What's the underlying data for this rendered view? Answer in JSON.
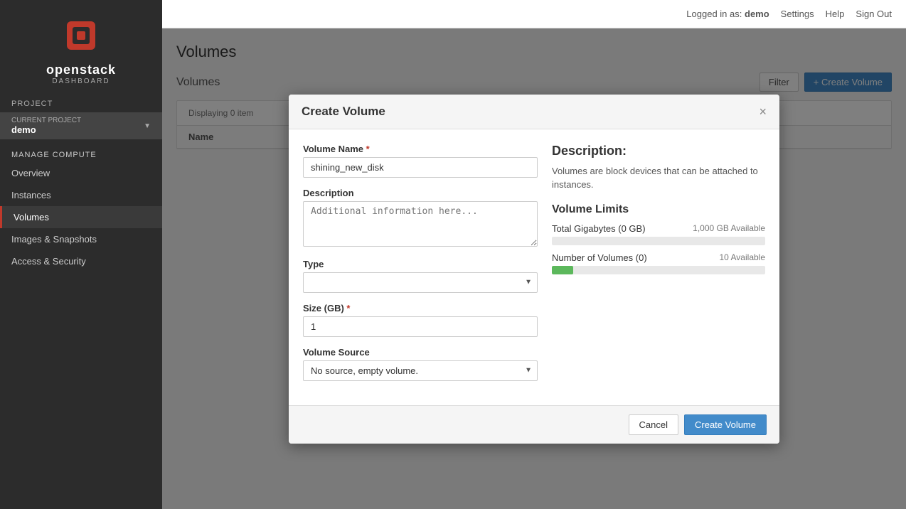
{
  "app": {
    "logo_alt": "OpenStack",
    "openstack_label": "openstack",
    "dashboard_label": "dashboard"
  },
  "topbar": {
    "logged_in_label": "Logged in as:",
    "username": "demo",
    "settings_label": "Settings",
    "help_label": "Help",
    "signout_label": "Sign Out"
  },
  "page": {
    "title": "Volumes",
    "subtitle": "Volumes",
    "filter_label": "Filter",
    "create_label": "+ Create Volume",
    "table_info": "Displaying 0 item"
  },
  "table": {
    "col_name": "Name"
  },
  "sidebar": {
    "project_label": "Project",
    "current_project_label": "CURRENT PROJECT",
    "current_project": "demo",
    "manage_compute_label": "Manage Compute",
    "items": [
      {
        "id": "overview",
        "label": "Overview",
        "active": false
      },
      {
        "id": "instances",
        "label": "Instances",
        "active": false
      },
      {
        "id": "volumes",
        "label": "Volumes",
        "active": true
      },
      {
        "id": "images-snapshots",
        "label": "Images & Snapshots",
        "active": false
      },
      {
        "id": "access-security",
        "label": "Access & Security",
        "active": false
      }
    ]
  },
  "modal": {
    "title": "Create Volume",
    "close_label": "×",
    "volume_name_label": "Volume Name",
    "volume_name_value": "shining_new_disk",
    "description_label": "Description",
    "description_placeholder": "Additional information here...",
    "type_label": "Type",
    "type_placeholder": "",
    "size_label": "Size (GB)",
    "size_value": "1",
    "volume_source_label": "Volume Source",
    "volume_source_value": "No source, empty volume.",
    "desc_title": "Description:",
    "desc_text": "Volumes are block devices that can be attached to instances.",
    "limits_title": "Volume Limits",
    "total_gigabytes_label": "Total Gigabytes",
    "total_gigabytes_used": "0 GB",
    "total_gigabytes_available": "1,000 GB Available",
    "number_of_volumes_label": "Number of Volumes",
    "number_of_volumes_used": "0",
    "number_of_volumes_available": "10 Available",
    "gigabytes_progress": 0,
    "volumes_progress": 10,
    "cancel_label": "Cancel",
    "create_label": "Create Volume"
  }
}
